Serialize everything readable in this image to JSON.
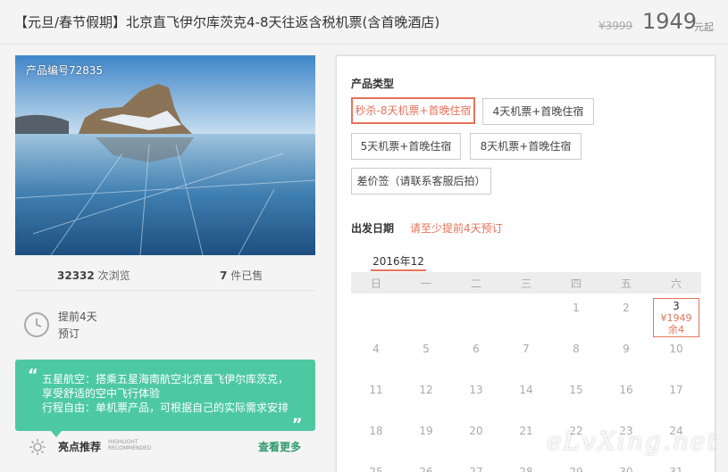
{
  "header": {
    "title": "【元旦/春节假期】北京直飞伊尔库茨克4-8天往返含税机票(含首晚酒店)",
    "original_price": "¥3999",
    "price": "1949",
    "price_unit": "元起"
  },
  "product": {
    "code_label": "产品编号72835",
    "views_count": "32332",
    "views_label": "次浏览",
    "sold_count": "7",
    "sold_label": "件已售",
    "advance_line1": "提前4天",
    "advance_line2": "预订"
  },
  "promo": {
    "lines": [
      "五星航空：搭乘五星海南航空北京直飞伊尔库茨克，",
      "享受舒适的空中飞行体验",
      "行程自由：单机票产品，可根据自己的实际需求安排"
    ],
    "highlight_cn": "亮点推荐",
    "highlight_en_1": "HIGHLIGHT",
    "highlight_en_2": "RECOMMENDED",
    "see_more": "查看更多"
  },
  "booking": {
    "type_label": "产品类型",
    "options": [
      "秒杀-8天机票+首晚住宿",
      "4天机票+首晚住宿",
      "5天机票+首晚住宿",
      "8天机票+首晚住宿",
      "差价签（请联系客服后拍）"
    ],
    "selected_option": 0,
    "date_label": "出发日期",
    "date_hint": "请至少提前4天预订",
    "month": "2016年12",
    "weekdays": [
      "日",
      "一",
      "二",
      "三",
      "四",
      "五",
      "六"
    ],
    "rows": [
      [
        "",
        "",
        "",
        "",
        "1",
        "2",
        "3"
      ],
      [
        "4",
        "5",
        "6",
        "7",
        "8",
        "9",
        "10"
      ],
      [
        "11",
        "12",
        "13",
        "14",
        "15",
        "16",
        "17"
      ],
      [
        "18",
        "19",
        "20",
        "21",
        "22",
        "23",
        "24"
      ],
      [
        "25",
        "26",
        "27",
        "28",
        "29",
        "30",
        "31"
      ]
    ],
    "available_day": {
      "day": "3",
      "price": "¥1949",
      "stock": "余4"
    }
  },
  "watermark": "eLvXing.net",
  "colors": {
    "accent": "#e6735a",
    "green": "#4dc9a1",
    "link_green": "#2f9a6e"
  }
}
